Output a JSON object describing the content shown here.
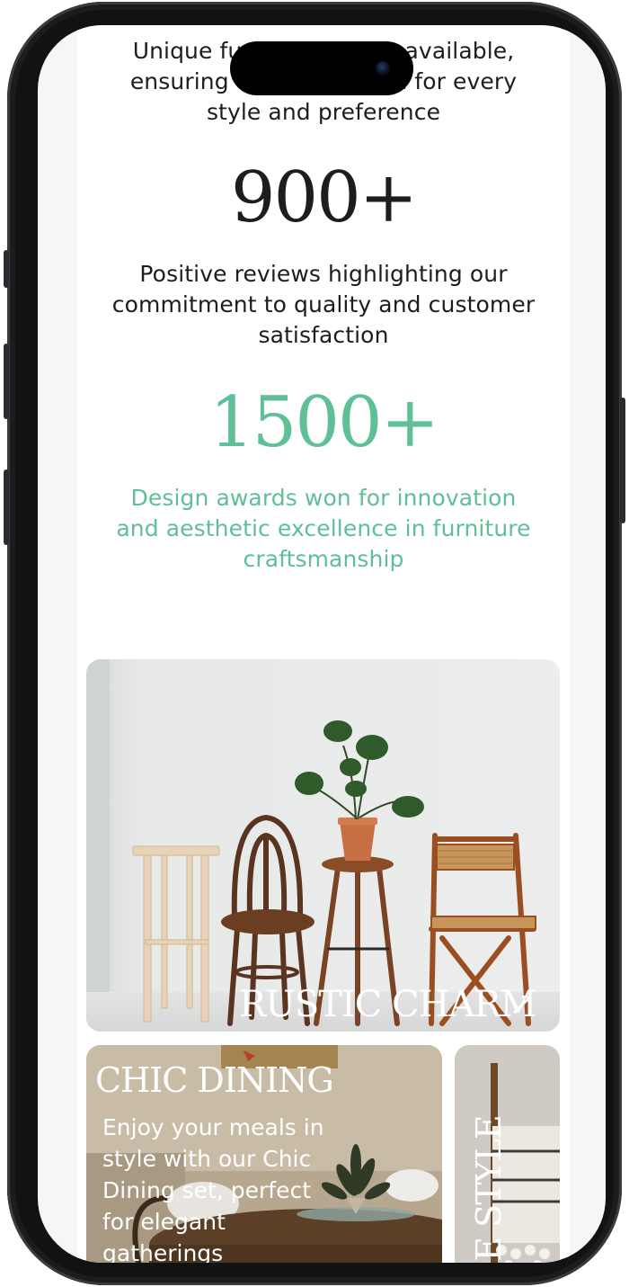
{
  "stats": {
    "intro_lines": [
      "Unique furniture pieces available,",
      "ensuring options chosen for every",
      "style and preference"
    ],
    "reviews_value": "900+",
    "reviews_lines": [
      "Positive reviews highlighting our",
      "commitment to quality and customer",
      "satisfaction"
    ],
    "awards_value": "1500+",
    "awards_lines": [
      "Design awards won for innovation",
      "and aesthetic excellence in furniture",
      "craftsmanship"
    ]
  },
  "cards": {
    "rustic": {
      "title": "RUSTIC CHARM",
      "arrow": "↗"
    },
    "chic": {
      "title": "CHIC DINING",
      "desc_lines": [
        "Enjoy your meals in",
        "style with our Chic",
        "Dining set, perfect",
        "for elegant",
        "gatherings"
      ]
    },
    "third": {
      "title": "GE STYLE"
    }
  },
  "colors": {
    "accent_green": "#5fbf97",
    "text_dark": "#1d1d1d",
    "phone_frame": "#111214"
  },
  "icons": [
    "arrow-up-right-icon",
    "camera-icon"
  ]
}
